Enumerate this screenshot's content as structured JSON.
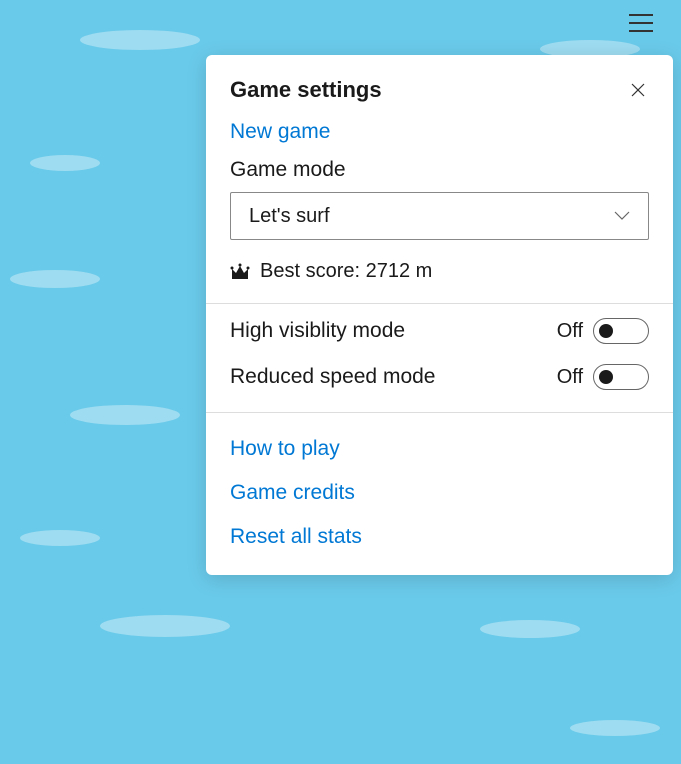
{
  "panel": {
    "title": "Game settings",
    "new_game": "New game",
    "game_mode_label": "Game mode",
    "game_mode_value": "Let's surf",
    "best_score_label": "Best score: 2712 m"
  },
  "toggles": {
    "high_visibility": {
      "label": "High visiblity mode",
      "state": "Off"
    },
    "reduced_speed": {
      "label": "Reduced speed mode",
      "state": "Off"
    }
  },
  "links": {
    "how_to_play": "How to play",
    "game_credits": "Game credits",
    "reset_stats": "Reset all stats"
  }
}
